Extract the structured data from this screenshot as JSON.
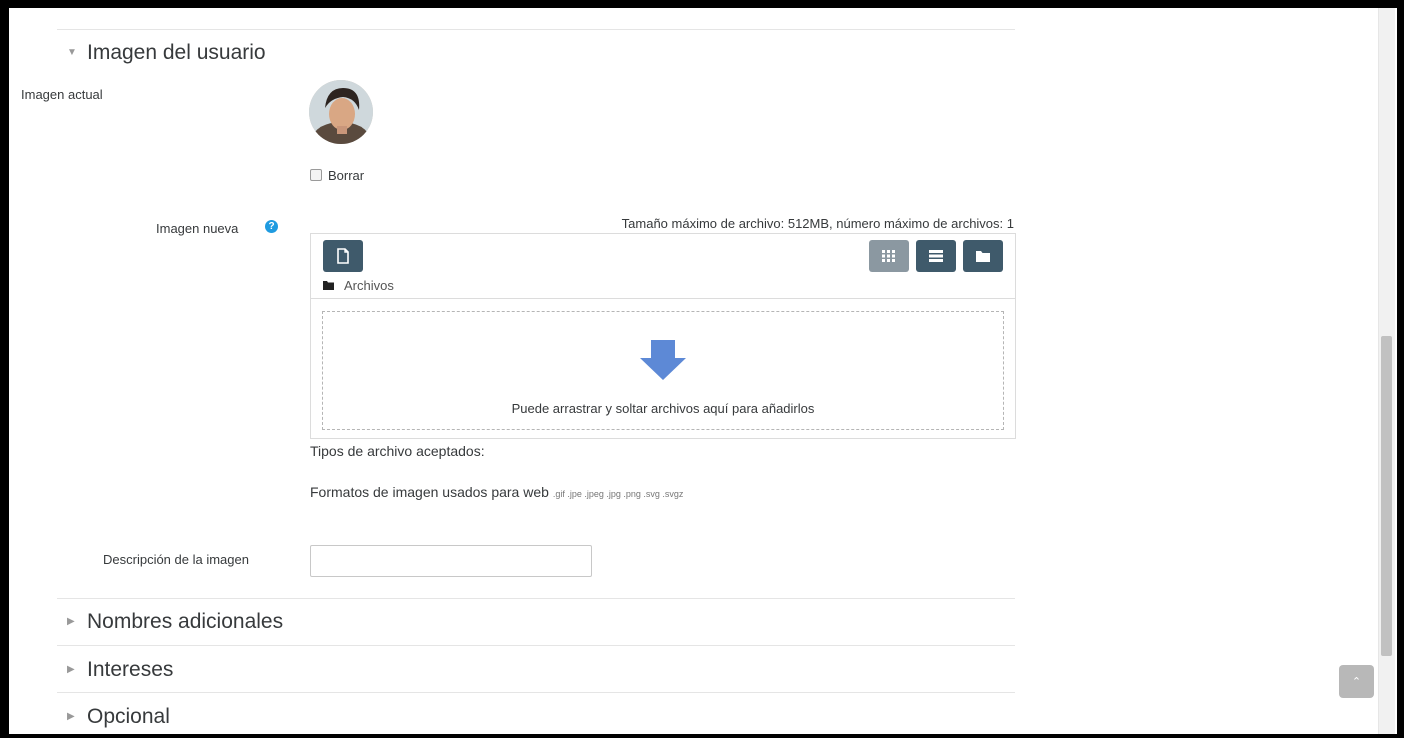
{
  "sections": {
    "user_image": {
      "title": "Imagen del usuario"
    },
    "additional_names": {
      "title": "Nombres adicionales"
    },
    "interests": {
      "title": "Intereses"
    },
    "optional": {
      "title": "Opcional"
    }
  },
  "current_image": {
    "label": "Imagen actual",
    "delete_label": "Borrar",
    "delete_checked": false
  },
  "new_image": {
    "label": "Imagen nueva",
    "limits": "Tamaño máximo de archivo: 512MB, número máximo de archivos: 1",
    "path_label": "Archivos",
    "drop_text": "Puede arrastrar y soltar archivos aquí para añadirlos",
    "accepted_label": "Tipos de archivo aceptados:",
    "formats_label": "Formatos de imagen usados para web",
    "formats_ext": ".gif .jpe .jpeg .jpg .png .svg .svgz",
    "view_mode_active": "icons"
  },
  "image_description": {
    "label": "Descripción de la imagen",
    "value": ""
  },
  "icons": {
    "section_expanded": "caret-down-icon",
    "section_collapsed": "caret-right-icon",
    "help": "question-circle-icon",
    "add_file": "file-icon",
    "view_icons": "grid-icon",
    "view_list": "list-icon",
    "view_tree": "folder-icon",
    "path": "folder-icon",
    "drop": "arrow-down-icon",
    "back_to_top": "chevron-up-icon"
  },
  "colors": {
    "accent_button": "#3f5a6b",
    "help": "#1f9be0",
    "drop_arrow": "#5d89d6"
  }
}
